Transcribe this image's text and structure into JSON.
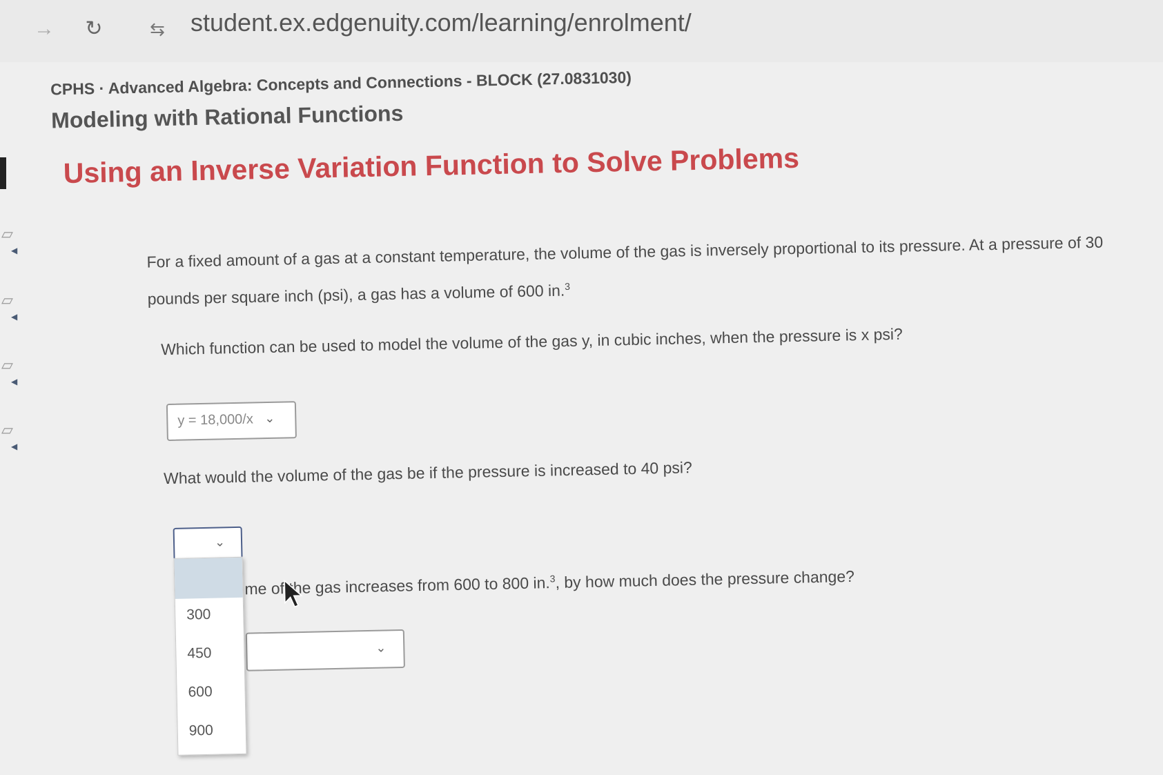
{
  "browser": {
    "url": "student.ex.edgenuity.com/learning/enrolment/"
  },
  "course": {
    "title": "CPHS · Advanced Algebra: Concepts and Connections - BLOCK (27.0831030)",
    "lesson": "Modeling with Rational Functions"
  },
  "page": {
    "heading": "Using an Inverse Variation Function to Solve Problems"
  },
  "problem": {
    "prompt_part1": "For a fixed amount of a gas at a constant temperature, the volume of the gas is inversely proportional to its pressure. At a pressure of 30 pounds per square inch (psi), a gas has a volume of 600 in.",
    "prompt_unit_exp": "3",
    "question1": "Which function can be used to model the volume of the gas y, in cubic inches, when the pressure is x psi?",
    "answer1": "y = 18,000/x",
    "question2": "What would the volume of the gas be if the pressure is increased to 40 psi?",
    "answer2_options": [
      "300",
      "450",
      "600",
      "900"
    ],
    "question3_part1": "me of the gas increases from 600 to 800 in.",
    "question3_exp": "3",
    "question3_part2": ", by how much does the pressure change?"
  },
  "icons": {
    "back": "back-arrow-icon",
    "reload": "reload-icon",
    "site_info": "site-info-icon",
    "dropdown": "chevron-down-icon",
    "cursor": "mouse-pointer-icon"
  },
  "colors": {
    "heading": "#c9494d",
    "dropdown_highlight": "#cfdbe5",
    "active_select_border": "#4d5f8a"
  }
}
